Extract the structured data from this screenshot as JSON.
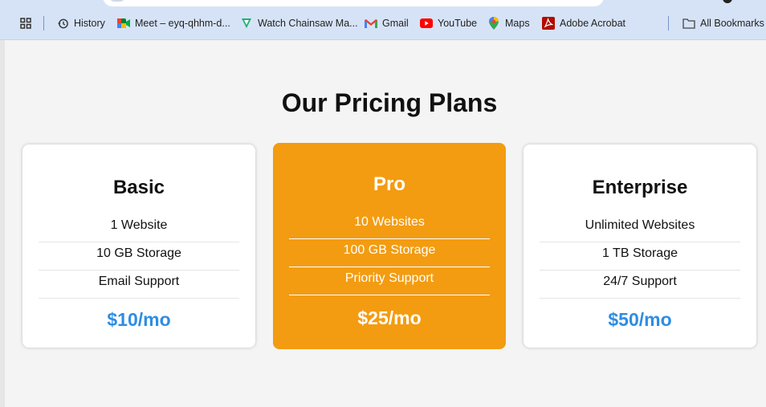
{
  "bookmarks": {
    "items": [
      {
        "label": "History",
        "icon": "history-icon"
      },
      {
        "label": "Meet – eyq-qhhm-d...",
        "icon": "meet-icon"
      },
      {
        "label": "Watch Chainsaw Ma...",
        "icon": "watch-icon"
      },
      {
        "label": "Gmail",
        "icon": "gmail-icon"
      },
      {
        "label": "YouTube",
        "icon": "youtube-icon"
      },
      {
        "label": "Maps",
        "icon": "maps-icon"
      },
      {
        "label": "Adobe Acrobat",
        "icon": "acrobat-icon"
      }
    ],
    "all_bookmarks": "All Bookmarks"
  },
  "page": {
    "title": "Our Pricing Plans"
  },
  "plans": [
    {
      "name": "Basic",
      "features": [
        "1 Website",
        "10 GB Storage",
        "Email Support"
      ],
      "price": "$10/mo"
    },
    {
      "name": "Pro",
      "features": [
        "10 Websites",
        "100 GB Storage",
        "Priority Support"
      ],
      "price": "$25/mo"
    },
    {
      "name": "Enterprise",
      "features": [
        "Unlimited Websites",
        "1 TB Storage",
        "24/7 Support"
      ],
      "price": "$50/mo"
    }
  ],
  "colors": {
    "accent_price": "#2e8de4",
    "highlight_card": "#f39c12",
    "bookmarks_bar": "#d6e3f7"
  }
}
